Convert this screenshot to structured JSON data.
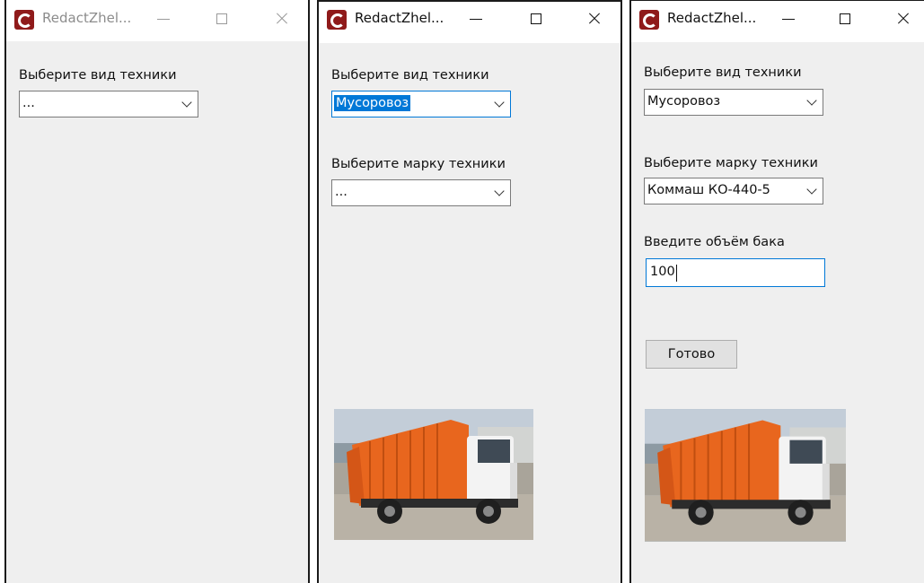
{
  "colors": {
    "accent": "#0078d7",
    "window_bg": "#efefef",
    "app_icon": "#8f1a1a",
    "truck_body": "#e8661e"
  },
  "windows": [
    {
      "title": "RedactZhel...",
      "type_label": "Выберите вид техники",
      "type_value": "..."
    },
    {
      "title": "RedactZhel...",
      "type_label": "Выберите вид техники",
      "type_value": "Мусоровоз",
      "brand_label": "Выберите марку техники",
      "brand_value": "..."
    },
    {
      "title": "RedactZhel...",
      "type_label": "Выберите вид техники",
      "type_value": "Мусоровоз",
      "brand_label": "Выберите марку техники",
      "brand_value": "Коммаш КО-440-5",
      "volume_label": "Введите объём бака",
      "volume_value": "100",
      "done_label": "Готово"
    }
  ],
  "icons": [
    "app-icon",
    "minimize-icon",
    "maximize-icon",
    "close-icon",
    "chevron-down-icon",
    "garbage-truck-image"
  ]
}
